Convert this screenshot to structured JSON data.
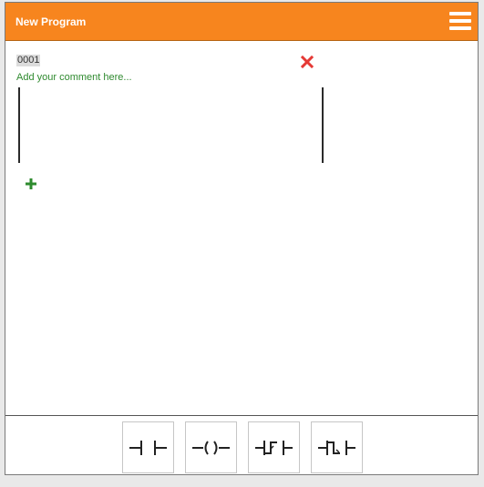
{
  "title_bar": {
    "title": "New Program",
    "accent_color": "#f7851e",
    "menu_icon": "hamburger-menu-icon"
  },
  "editor": {
    "rungs": [
      {
        "number": "0001",
        "comment_placeholder": "Add your comment here...",
        "delete_icon": "close-icon",
        "delete_color": "#e53935"
      }
    ],
    "add_icon": "plus-icon",
    "add_color": "#2e8b2e"
  },
  "toolbar": {
    "tools": [
      {
        "icon": "normally-open-contact-icon"
      },
      {
        "icon": "output-coil-icon"
      },
      {
        "icon": "rising-edge-contact-icon"
      },
      {
        "icon": "falling-edge-contact-icon"
      }
    ]
  }
}
